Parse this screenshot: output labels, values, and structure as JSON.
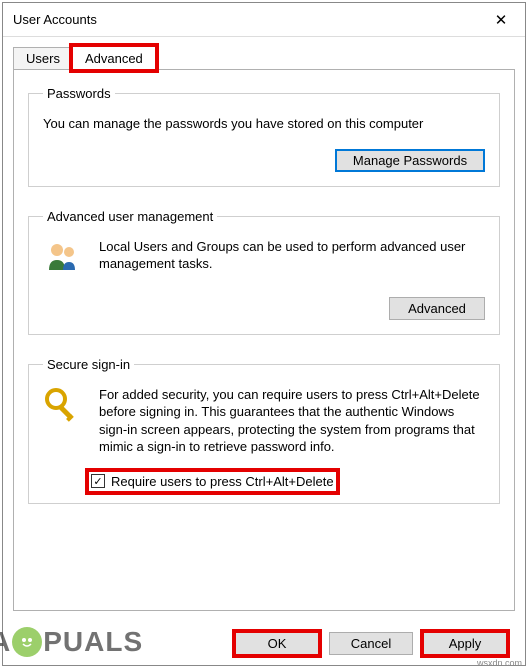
{
  "window": {
    "title": "User Accounts"
  },
  "tabs": {
    "users": "Users",
    "advanced": "Advanced"
  },
  "passwords_group": {
    "legend": "Passwords",
    "desc": "You can manage the passwords you have stored on this computer",
    "button": "Manage Passwords"
  },
  "aum_group": {
    "legend": "Advanced user management",
    "desc": "Local Users and Groups can be used to perform advanced user management tasks.",
    "button": "Advanced"
  },
  "secure_group": {
    "legend": "Secure sign-in",
    "desc": "For added security, you can require users to press Ctrl+Alt+Delete before signing in. This guarantees that the authentic Windows sign-in screen appears, protecting the system from programs that mimic a sign-in to retrieve password info.",
    "checkbox_label": "Require users to press Ctrl+Alt+Delete",
    "checkbox_checked": true
  },
  "footer": {
    "ok": "OK",
    "cancel": "Cancel",
    "apply": "Apply"
  },
  "icons": {
    "close": "✕",
    "check": "✓"
  },
  "watermark": {
    "text_before": "A",
    "text_after": "PUALS",
    "corner": "wsxdn.com"
  },
  "highlights": [
    "tab-advanced",
    "secure-checkbox-row",
    "ok-button",
    "apply-button"
  ]
}
